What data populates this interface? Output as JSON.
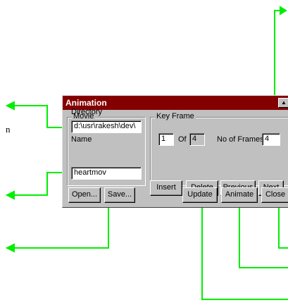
{
  "window": {
    "title": "Animation"
  },
  "movie": {
    "group_label": "Movie",
    "directory_label": "Directory",
    "directory_value": "d:\\usr\\rakesh\\dev\\",
    "name_label": "Name",
    "name_value": "heartmov"
  },
  "keyframe": {
    "group_label": "Key Frame",
    "current_frame": "1",
    "of_label": "Of",
    "total_frames": "4",
    "no_of_frames_label": "No of Frames",
    "no_of_frames_value": "4"
  },
  "buttons": {
    "insert": "Insert",
    "delete": "Delete",
    "previous": "Previous",
    "next": "Next",
    "open": "Open...",
    "save": "Save...",
    "update": "Update",
    "animate": "Animate",
    "close": "Close"
  },
  "icons": {
    "titlebar_button": "scroll-up-icon"
  },
  "side_text": "n",
  "colors": {
    "titlebar": "#840000",
    "callout": "#00ff00",
    "dialog": "#c0c0c0"
  }
}
